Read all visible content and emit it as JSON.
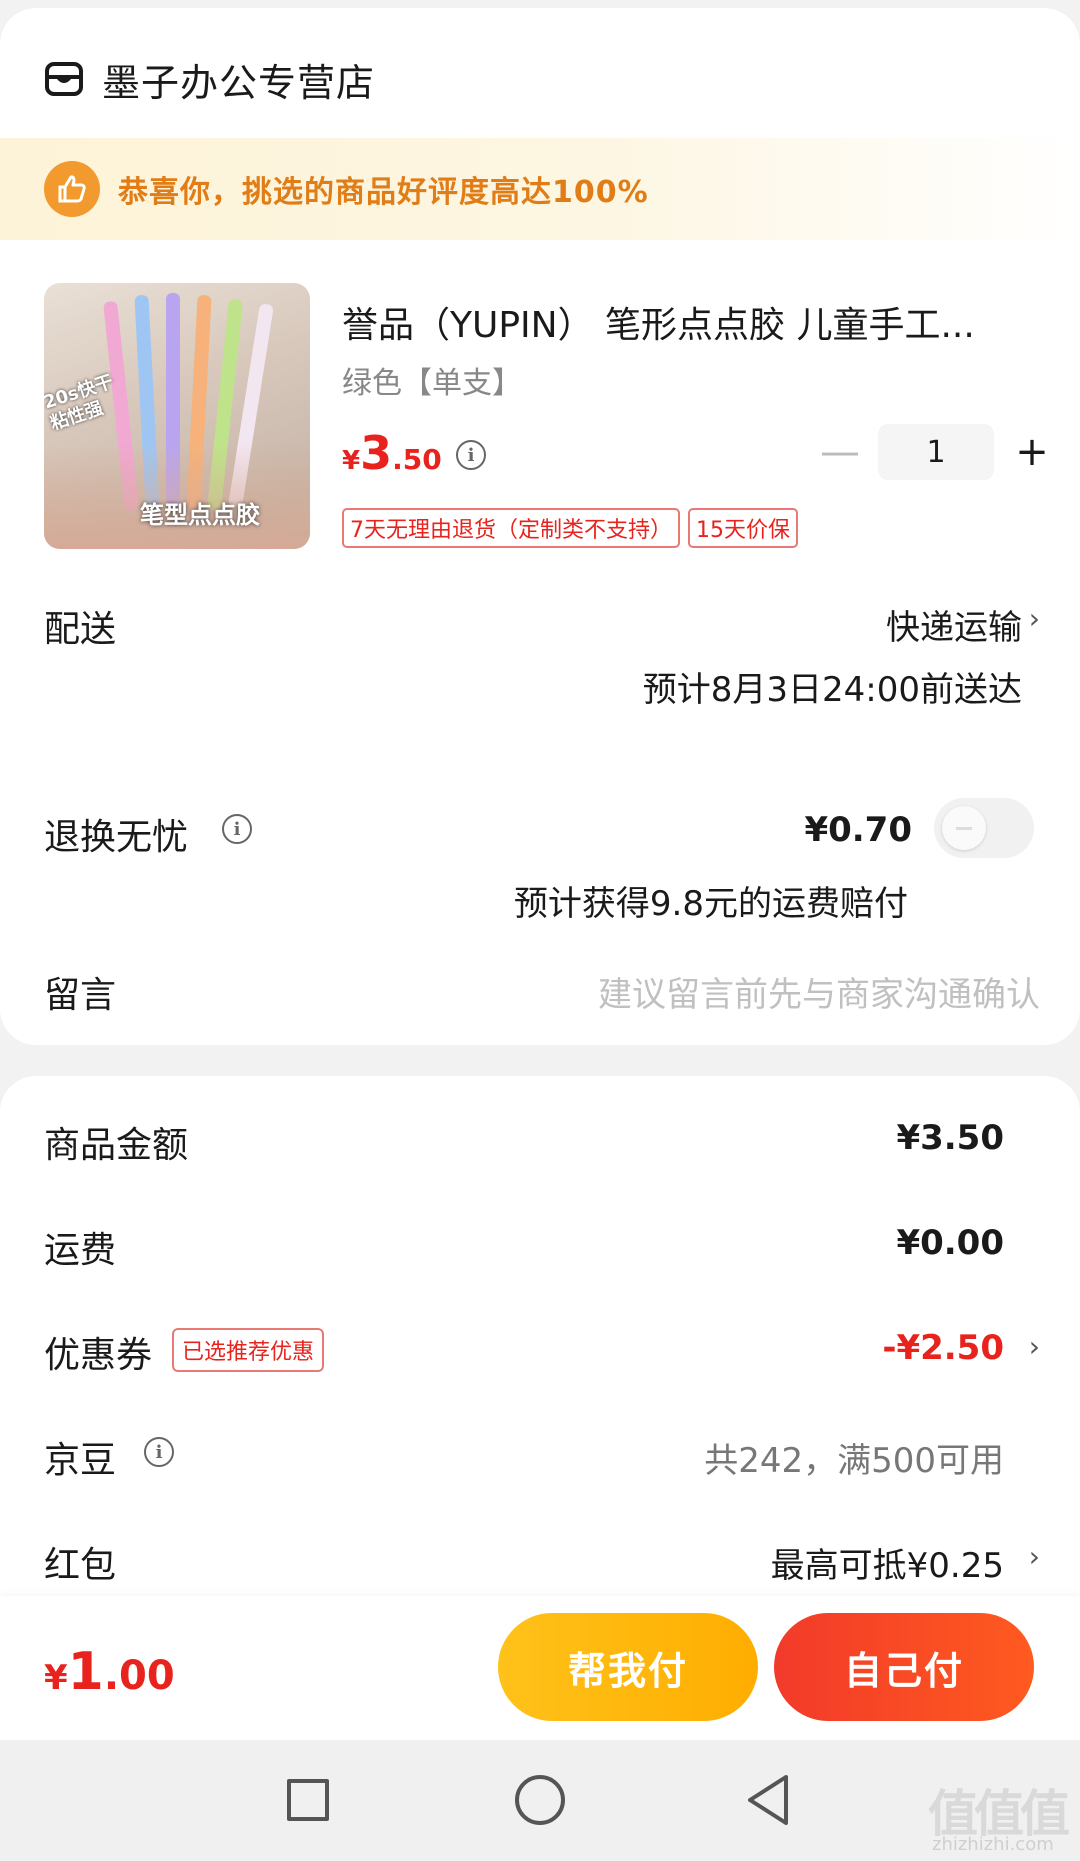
{
  "store": {
    "name": "墨子办公专营店",
    "icon": "store-icon"
  },
  "banner": {
    "text": "恭喜你，挑选的商品好评度高达100%",
    "icon": "thumbs-up-icon",
    "color": "#e07d17"
  },
  "product": {
    "title": "誉品（YUPIN） 笔形点点胶 儿童手工...",
    "spec": "绿色【单支】",
    "price": {
      "yen": "¥",
      "int": "3",
      "dec": ".50"
    },
    "quantity": "1",
    "minus": "—",
    "plus": "+",
    "tags": [
      "7天无理由退货（定制类不支持）",
      "15天价保"
    ],
    "image_text": {
      "top": "20s快干 粘性强",
      "bottom": "笔型点点胶"
    }
  },
  "delivery": {
    "label": "配送",
    "method": "快递运输",
    "eta": "预计8月3日24:00前送达"
  },
  "return_insurance": {
    "label": "退换无忧",
    "price": "¥0.70",
    "desc": "预计获得9.8元的运费赔付",
    "enabled": false
  },
  "remark": {
    "label": "留言",
    "placeholder": "建议留言前先与商家沟通确认"
  },
  "summary": {
    "goods_label": "商品金额",
    "goods_value": "¥3.50",
    "freight_label": "运费",
    "freight_value": "¥0.00",
    "coupon_label": "优惠券",
    "coupon_tag": "已选推荐优惠",
    "coupon_value": "-¥2.50",
    "jingdou_label": "京豆",
    "jingdou_value": "共242，满500可用",
    "redpacket_label": "红包",
    "redpacket_value": "最高可抵¥0.25"
  },
  "bottom": {
    "total": {
      "yen": "¥",
      "int": "1",
      "dec": ".00"
    },
    "help_pay": "帮我付",
    "self_pay": "自己付"
  },
  "watermark": {
    "main": "值值值",
    "sub": "zhizhizhi.com"
  },
  "colors": {
    "accent_red": "#e8231e",
    "accent_yellow": "#ffb300",
    "banner_orange": "#e07d17"
  }
}
